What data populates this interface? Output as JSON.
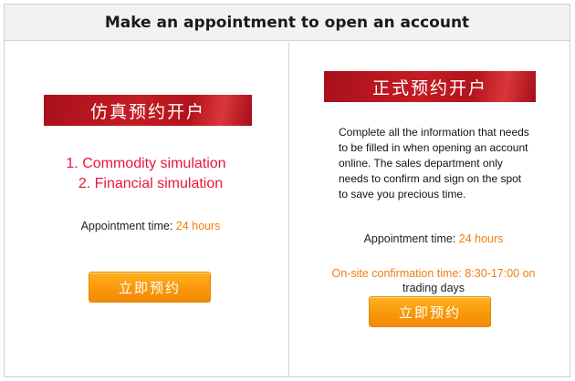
{
  "header": {
    "title": "Make an appointment to open an account"
  },
  "left_panel": {
    "banner": "仿真预约开户",
    "items": [
      "1. Commodity simulation",
      "2. Financial simulation"
    ],
    "appointment_label": "Appointment time: ",
    "appointment_value": "24 hours",
    "button_label": "立即预约"
  },
  "right_panel": {
    "banner": "正式预约开户",
    "description": "Complete all the information that needs to be filled in when opening an account online. The sales department only needs to confirm and sign on the spot to save you precious time.",
    "appointment_label": "Appointment time: ",
    "appointment_value": "24 hours",
    "onsite_time": "On-site confirmation time: 8:30-17:00 on",
    "onsite_sub": "trading days",
    "button_label": "立即预约"
  },
  "colors": {
    "banner_red": "#c41c24",
    "highlight_orange": "#f07d12",
    "simulation_pink": "#e8173a",
    "button_orange": "#f99a0c"
  }
}
